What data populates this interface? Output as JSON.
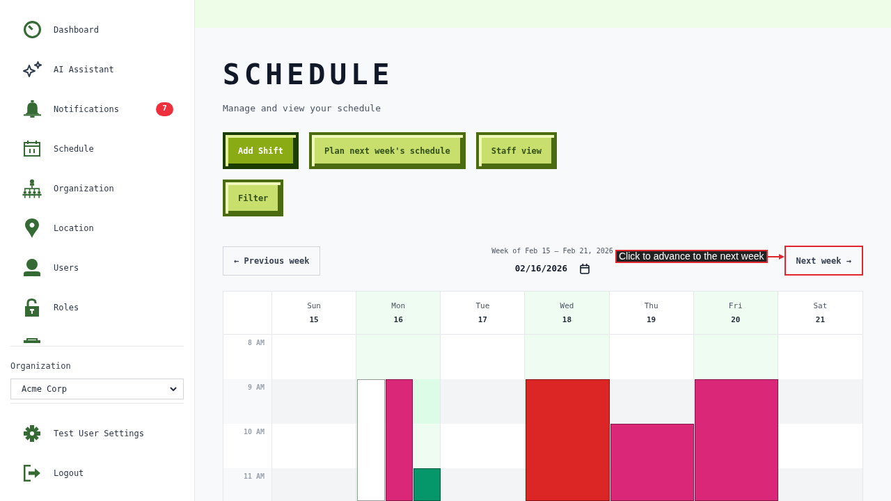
{
  "sidebar": {
    "nav_items": [
      {
        "label": "Dashboard"
      },
      {
        "label": "AI Assistant"
      },
      {
        "label": "Notifications",
        "badge": "7"
      },
      {
        "label": "Schedule"
      },
      {
        "label": "Organization"
      },
      {
        "label": "Location"
      },
      {
        "label": "Users"
      },
      {
        "label": "Roles"
      }
    ],
    "organization": {
      "label": "Organization",
      "value": "Acme Corp"
    },
    "footer_items": [
      {
        "label": "Test User Settings"
      },
      {
        "label": "Logout"
      }
    ]
  },
  "header": {
    "title": "SCHEDULE",
    "subtitle": "Manage and view your schedule"
  },
  "actions": [
    {
      "label": "Add Shift",
      "kind": "primary"
    },
    {
      "label": "Plan next week's schedule",
      "kind": "secondary"
    },
    {
      "label": "Staff view",
      "kind": "secondary"
    },
    {
      "label": "Filter",
      "kind": "secondary"
    }
  ],
  "week_nav": {
    "previous": {
      "label": "← Previous week"
    },
    "week_label": "Week of Feb 15 – Feb 21, 2026",
    "date": {
      "value": "02/16/2026"
    },
    "next": {
      "label": "Next week →",
      "highlighted": true
    },
    "annotation": {
      "text": "Click to advance to the next week"
    }
  },
  "calendar": {
    "days": [
      {
        "name": "Sun",
        "date": "15",
        "highlighted": false
      },
      {
        "name": "Mon",
        "date": "16",
        "highlighted": true
      },
      {
        "name": "Tue",
        "date": "17",
        "highlighted": false
      },
      {
        "name": "Wed",
        "date": "18",
        "highlighted": true
      },
      {
        "name": "Thu",
        "date": "19",
        "highlighted": false
      },
      {
        "name": "Fri",
        "date": "20",
        "highlighted": true
      },
      {
        "name": "Sat",
        "date": "21",
        "highlighted": false
      }
    ],
    "rows": [
      {
        "time": "8 AM",
        "shaded": false,
        "cells": [
          {},
          {},
          {},
          {},
          {},
          {},
          {}
        ]
      },
      {
        "time": "9 AM",
        "shaded": true,
        "cells": [
          {},
          {
            "events": [
              {
                "color": "#ffffff"
              },
              {
                "color": "#db2777"
              }
            ]
          },
          {},
          {
            "events": [
              {
                "color": "#dc2626"
              }
            ]
          },
          {},
          {
            "events": [
              {
                "color": "#db2777"
              }
            ]
          },
          {}
        ]
      },
      {
        "time": "10 AM",
        "shaded": false,
        "cells": [
          {},
          {},
          {},
          {},
          {
            "events": [
              {
                "color": "#db2777"
              }
            ]
          },
          {},
          {}
        ]
      },
      {
        "time": "11 AM",
        "shaded": true,
        "cells": [
          {},
          {
            "events": [
              {
                "color": "#059669"
              }
            ]
          },
          {},
          {},
          {},
          {},
          {}
        ]
      }
    ]
  }
}
